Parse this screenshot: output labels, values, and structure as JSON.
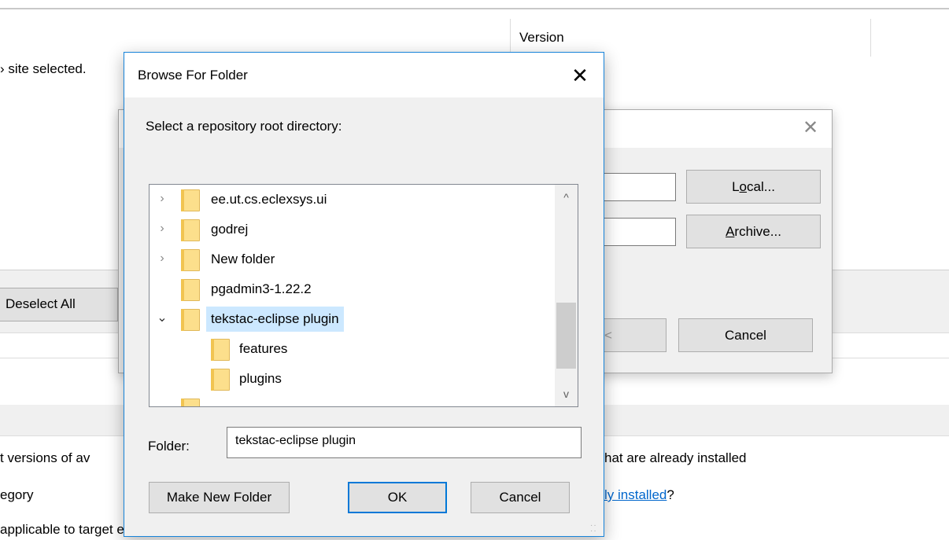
{
  "background": {
    "version_header": "Version",
    "no_site_text": "› site selected.",
    "deselect_all_label": "Deselect All",
    "line_versions": "t versions of av",
    "line_versions_right": "hat are already installed",
    "line_category": "egory",
    "line_installed_link": "ly installed",
    "line_installed_suffix": "?",
    "line_applicable": "applicable to target environment"
  },
  "add_repository_dialog": {
    "close_glyph": "✕",
    "local_button_pre": "L",
    "local_button_mnemonic": "o",
    "local_button_post": "cal...",
    "archive_button_mnemonic": "A",
    "archive_button_post": "rchive...",
    "ok_fragment": "<",
    "cancel_button": "Cancel"
  },
  "browse_dialog": {
    "title": "Browse For Folder",
    "close_glyph": "✕",
    "prompt": "Select a repository root directory:",
    "tree": [
      {
        "label": "ee.ut.cs.eclexsys.ui",
        "expander": "collapsed",
        "level": 0
      },
      {
        "label": "godrej",
        "expander": "collapsed",
        "level": 0
      },
      {
        "label": "New folder",
        "expander": "collapsed",
        "level": 0
      },
      {
        "label": "pgadmin3-1.22.2",
        "expander": "none",
        "level": 0
      },
      {
        "label": "tekstac-eclipse plugin",
        "expander": "expanded",
        "level": 0,
        "selected": true
      },
      {
        "label": "features",
        "expander": "none",
        "level": 1
      },
      {
        "label": "plugins",
        "expander": "none",
        "level": 1
      }
    ],
    "scroll_up_glyph": "^",
    "scroll_down_glyph": "v",
    "folder_label": "Folder:",
    "folder_value": "tekstac-eclipse plugin",
    "make_new_folder_button": "Make New Folder",
    "ok_button": "OK",
    "cancel_button": "Cancel"
  },
  "colors": {
    "selection": "#cce8ff",
    "dialog_border": "#1783d9",
    "link": "#0066cc",
    "folder_fill": "#fcdf8c"
  }
}
